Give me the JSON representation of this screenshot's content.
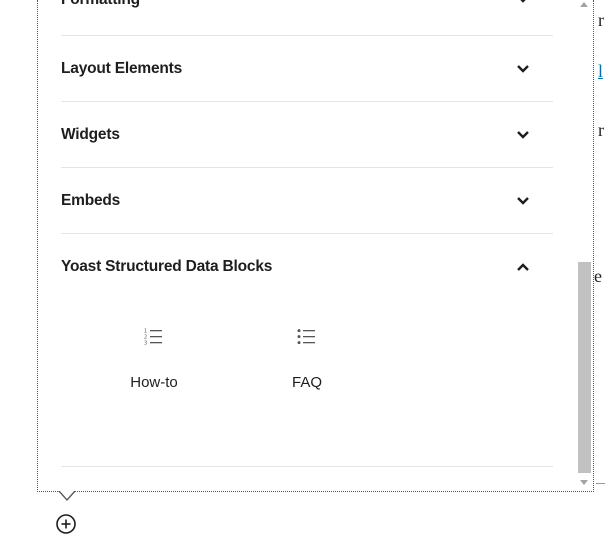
{
  "inserter": {
    "sections": [
      {
        "title": "Formatting",
        "expanded": false
      },
      {
        "title": "Layout Elements",
        "expanded": false
      },
      {
        "title": "Widgets",
        "expanded": false
      },
      {
        "title": "Embeds",
        "expanded": false
      },
      {
        "title": "Yoast Structured Data Blocks",
        "expanded": true
      }
    ],
    "blocks": [
      {
        "label": "How-to",
        "icon": "numbered-list-icon"
      },
      {
        "label": "FAQ",
        "icon": "bulleted-list-icon"
      }
    ]
  },
  "background_fragments": [
    "r",
    "l",
    "r",
    "e"
  ],
  "add_block_icon": "plus-circle-icon",
  "colors": {
    "link": "#0073aa",
    "divider": "#e2e4e7",
    "scroll_thumb": "#c1c1c1"
  }
}
